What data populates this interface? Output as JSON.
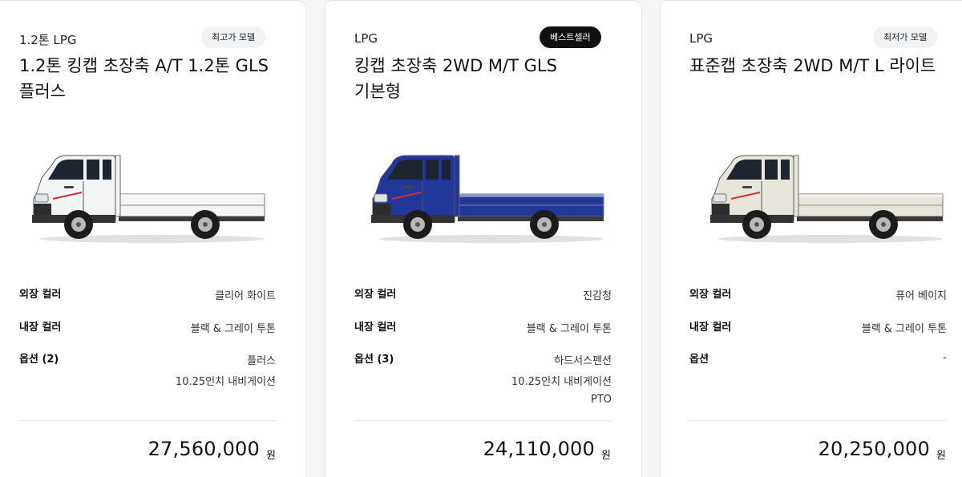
{
  "spec_labels": {
    "exterior": "외장 컬러",
    "interior": "내장 컬러"
  },
  "currency": "원",
  "cards": [
    {
      "fuel": "1.2톤 LPG",
      "badge": "최고가 모델",
      "title": "1.2톤 킹캡 초장축 A/T 1.2톤 GLS\n플러스",
      "truck_image": "white-truck",
      "body_color": "#f3f4f4",
      "exterior": "클리어 화이트",
      "interior": "블랙 & 그레이 투톤",
      "options_label": "옵션 (2)",
      "options": [
        "플러스",
        "10.25인치 내비게이션"
      ],
      "price": "27,560,000"
    },
    {
      "fuel": "LPG",
      "badge": "베스트셀러",
      "title": "킹캡 초장축 2WD M/T GLS\n기본형",
      "truck_image": "blue-truck",
      "body_color": "#22379a",
      "exterior": "진감청",
      "interior": "블랙 & 그레이 투톤",
      "options_label": "옵션 (3)",
      "options": [
        "하드서스펜션",
        "10.25인치 내비게이션",
        "PTO"
      ],
      "price": "24,110,000"
    },
    {
      "fuel": "LPG",
      "badge": "최저가 모델",
      "title": "표준캡 초장축 2WD M/T L 라이트",
      "truck_image": "beige-truck",
      "body_color": "#e8e5da",
      "exterior": "퓨어 베이지",
      "interior": "블랙 & 그레이 투톤",
      "options_label": "옵션",
      "options": [
        "-"
      ],
      "price": "20,250,000"
    }
  ]
}
